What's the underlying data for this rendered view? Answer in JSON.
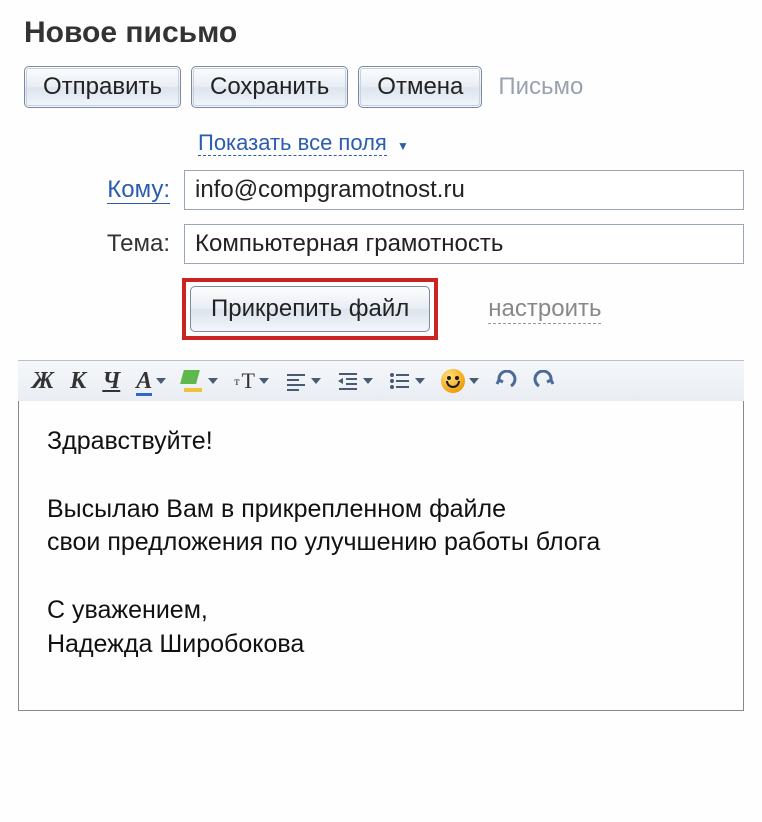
{
  "title": "Новое письмо",
  "toolbar": {
    "send": "Отправить",
    "save": "Сохранить",
    "cancel": "Отмена",
    "mode": "Письмо"
  },
  "fields": {
    "show_all": "Показать все поля",
    "to_label": "Кому:",
    "to_value": "info@compgramotnost.ru",
    "subject_label": "Тема:",
    "subject_value": "Компьютерная грамотность",
    "attach": "Прикрепить файл",
    "configure": "настроить"
  },
  "editor_icons": {
    "bold": "Ж",
    "italic": "К",
    "underline": "Ч",
    "fontcolor": "А",
    "fontsize": "тТ"
  },
  "body_text": "Здравствуйте!\n\nВысылаю Вам в прикрепленном файле\nсвои предложения по улучшению работы блога\n\nС уважением,\nНадежда Широбокова"
}
